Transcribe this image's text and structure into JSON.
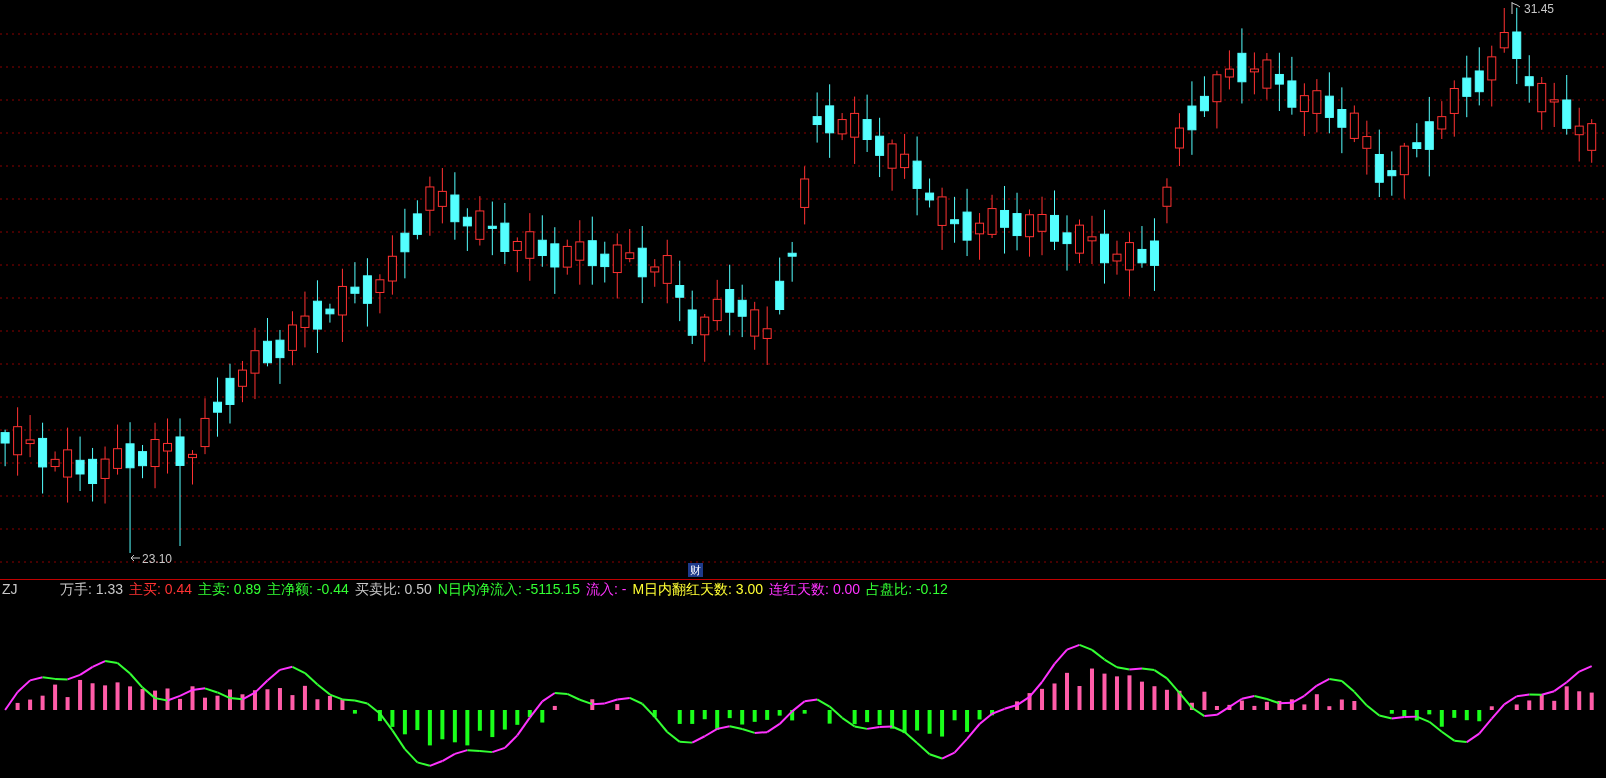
{
  "chart": {
    "high_label": "31.45",
    "low_label": "23.10",
    "badge": "财"
  },
  "indicator": {
    "name": "ZJ",
    "fields": [
      {
        "text": "万手: 1.33",
        "color": "#c8c8c8"
      },
      {
        "text": "主买: 0.44",
        "color": "#ff3232"
      },
      {
        "text": "主卖: 0.89",
        "color": "#33ff33"
      },
      {
        "text": "主净额: -0.44",
        "color": "#33ff33"
      },
      {
        "text": "买卖比: 0.50",
        "color": "#c8c8c8"
      },
      {
        "text": "N日内净流入: -5115.15",
        "color": "#33ff33"
      },
      {
        "text": "流入: -",
        "color": "#ff33ff"
      },
      {
        "text": "M日内翻红天数: 3.00",
        "color": "#ffff33"
      },
      {
        "text": "连红天数: 0.00",
        "color": "#ff33ff"
      },
      {
        "text": "占盘比: -0.12",
        "color": "#33ff33"
      }
    ]
  }
}
